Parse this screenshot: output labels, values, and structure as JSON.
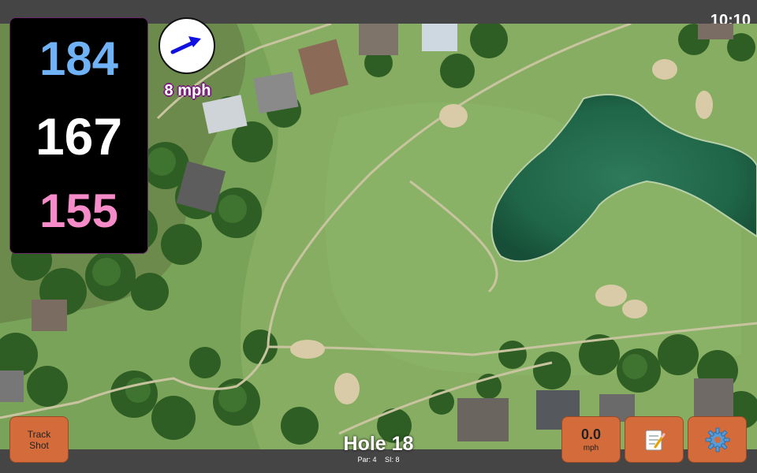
{
  "status": {
    "time": "10:10"
  },
  "distances": {
    "back": "184",
    "middle": "167",
    "front": "155"
  },
  "wind": {
    "speed_text": "8 mph"
  },
  "hole": {
    "title": "Hole 18",
    "par_text": "Par: 4",
    "si_text": "SI: 8"
  },
  "buttons": {
    "track_line1": "Track",
    "track_line2": "Shot",
    "speed_value": "0.0",
    "speed_unit": "mph",
    "notes_icon": "notepad-icon",
    "settings_icon": "gear-icon"
  },
  "colors": {
    "back_distance": "#6fb2f5",
    "middle_distance": "#ffffff",
    "front_distance": "#f58bc8",
    "button_bg": "#d36c3a",
    "wind_arrow": "#1010e0"
  }
}
